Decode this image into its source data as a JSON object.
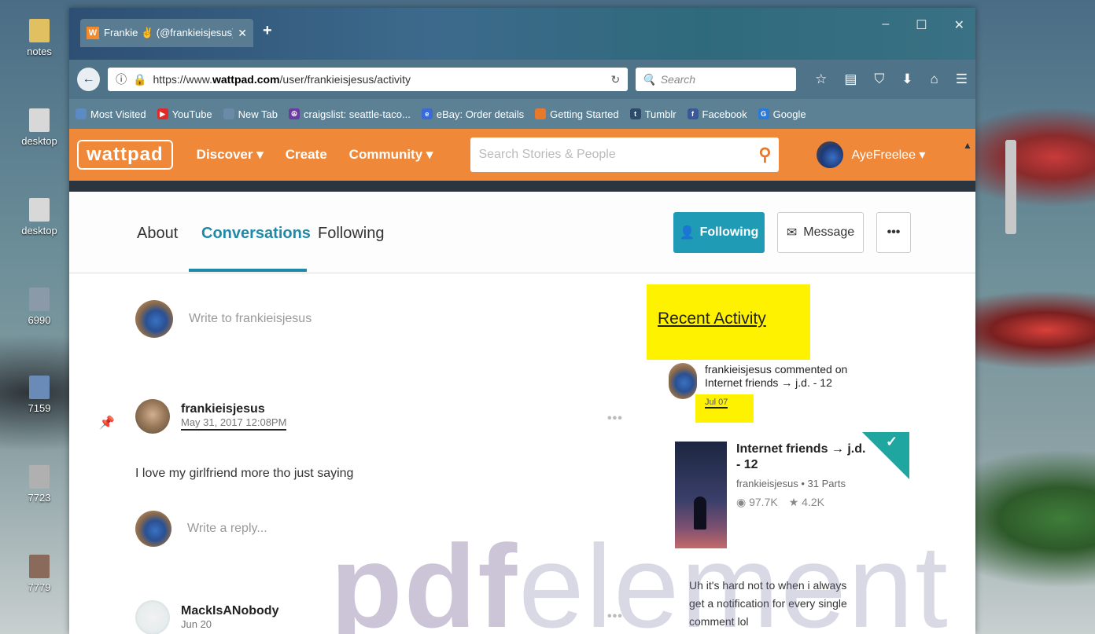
{
  "desktop": {
    "icons": [
      {
        "label": "notes"
      },
      {
        "label": "desktop"
      },
      {
        "label": "desktop"
      },
      {
        "label": "6990"
      },
      {
        "label": "7159"
      },
      {
        "label": "7723"
      },
      {
        "label": "7779"
      }
    ]
  },
  "browser": {
    "tab_title": "Frankie ✌ (@frankieisjesus)",
    "url_prefix": "https://www.",
    "url_domain": "wattpad.com",
    "url_path": "/user/frankieisjesus/activity",
    "search_placeholder": "Search",
    "bookmarks": [
      {
        "label": "Most Visited",
        "color": "#5c8ac2"
      },
      {
        "label": "YouTube",
        "color": "#e02a2a"
      },
      {
        "label": "New Tab",
        "color": "#6a8aa8"
      },
      {
        "label": "craigslist: seattle-taco...",
        "color": "#6a3ca0"
      },
      {
        "label": "eBay: Order details",
        "color": "#3a6ad8"
      },
      {
        "label": "Getting Started",
        "color": "#e8782a"
      },
      {
        "label": "Tumblr",
        "color": "#2d4a6a"
      },
      {
        "label": "Facebook",
        "color": "#3b5998"
      },
      {
        "label": "Google",
        "color": "#2a7ad8"
      }
    ]
  },
  "wattpad": {
    "logo": "wattpad",
    "nav": {
      "discover": "Discover ▾",
      "create": "Create",
      "community": "Community ▾"
    },
    "search_placeholder": "Search Stories & People",
    "user": "AyeFreelee ▾"
  },
  "profile": {
    "tabs": {
      "about": "About",
      "conversations": "Conversations",
      "following": "Following"
    },
    "following_btn": "Following",
    "message_btn": "Message",
    "more_btn": "•••"
  },
  "feed": {
    "write_placeholder": "Write to frankieisjesus",
    "post": {
      "author": "frankieisjesus",
      "date": "May 31, 2017 12:08PM",
      "text": "I love my girlfriend more tho just saying",
      "more": "•••"
    },
    "reply_placeholder": "Write a reply...",
    "post2": {
      "author": "MackIsANobody",
      "date": "Jun 20",
      "more": "•••"
    }
  },
  "sidebar": {
    "title": "Recent Activity",
    "activity_text": "frankieisjesus commented on Internet friends → j.d. - 12",
    "activity_date": "Jul 07",
    "story": {
      "title": "Internet friends → j.d. - 12",
      "meta": "frankieisjesus • 31 Parts",
      "reads": "97.7K",
      "votes": "4.2K"
    },
    "comment": "Uh it's hard not to when i always get a notification for every single comment lol"
  },
  "watermark": {
    "pre": "pdf",
    "post": "element"
  }
}
